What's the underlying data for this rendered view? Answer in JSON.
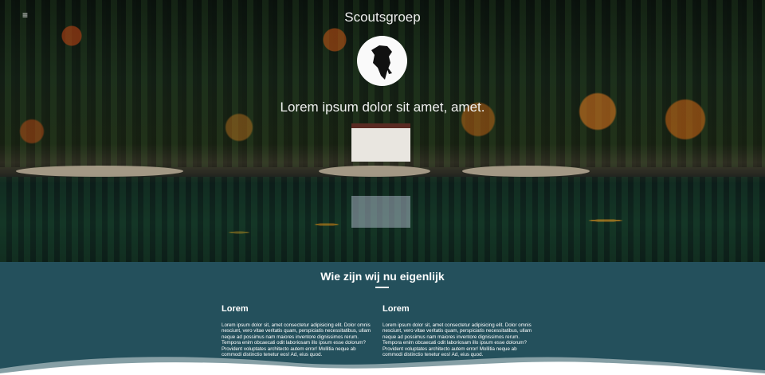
{
  "nav": {
    "menu_icon": "hamburger-menu-icon",
    "menu_glyph": "≡"
  },
  "hero": {
    "site_title": "Scoutsgroep",
    "logo_icon": "scout-silhouette-icon",
    "tagline": "Lorem ipsum dolor sit amet, amet."
  },
  "about": {
    "title": "Wie zijn wij nu eigenlijk",
    "columns": [
      {
        "heading": "Lorem",
        "text": "Lorem ipsum dolor sit, amet consectetur adipisicing elit. Dolor omnis nesciunt, vero vitae veritatis quam, perspiciatis necessitatibus, ullam neque ad possimus nam maiores inventore dignissimos rerum. Tempora enim obcaecati odit laboriosam illo ipsum esse dolorum? Provident voluptates architecto autem error! Mollitia neque ab commodi distinctio tenetur eos! Ad, eius quod."
      },
      {
        "heading": "Lorem",
        "text": "Lorem ipsum dolor sit, amet consectetur adipisicing elit. Dolor omnis nesciunt, vero vitae veritatis quam, perspiciatis necessitatibus, ullam neque ad possimus nam maiores inventore dignissimos rerum. Tempora enim obcaecati odit laboriosam illo ipsum esse dolorum? Provident voluptates architecto autem error! Mollitia neque ab commodi distinctio tenetur eos! Ad, eius quod."
      }
    ]
  },
  "colors": {
    "section_bg": "#24505c",
    "wave": "#ffffff"
  }
}
